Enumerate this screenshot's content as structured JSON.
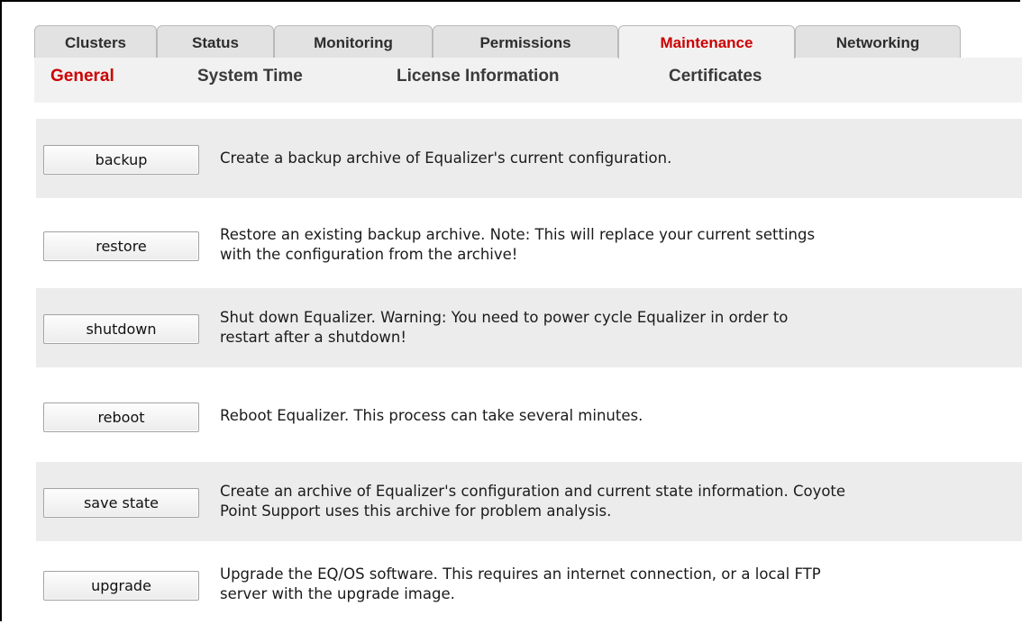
{
  "tabs": [
    {
      "label": "Clusters",
      "active": false
    },
    {
      "label": "Status",
      "active": false
    },
    {
      "label": "Monitoring",
      "active": false
    },
    {
      "label": "Permissions",
      "active": false
    },
    {
      "label": "Maintenance",
      "active": true
    },
    {
      "label": "Networking",
      "active": false
    }
  ],
  "subtabs": [
    {
      "label": "General",
      "active": true
    },
    {
      "label": "System Time",
      "active": false
    },
    {
      "label": "License Information",
      "active": false
    },
    {
      "label": "Certificates",
      "active": false
    }
  ],
  "actions": [
    {
      "button": "backup",
      "description": "Create a backup archive of Equalizer's current configuration."
    },
    {
      "button": "restore",
      "description": "Restore an existing backup archive. Note: This will replace your current settings\nwith the configuration from the archive!"
    },
    {
      "button": "shutdown",
      "description": "Shut down Equalizer. Warning: You need to power cycle Equalizer in order to\nrestart after a shutdown!"
    },
    {
      "button": "reboot",
      "description": "Reboot Equalizer. This process can take several minutes."
    },
    {
      "button": "save state",
      "description": "Create an archive of Equalizer's configuration and current state information. Coyote\nPoint Support uses this archive for problem analysis."
    },
    {
      "button": "upgrade",
      "description": "Upgrade the EQ/OS software. This requires an internet connection, or a local FTP\nserver with the upgrade image."
    }
  ],
  "colors": {
    "accent": "#cc0000",
    "tab_bg": "#e2e2e2",
    "panel_bg": "#f1f1f1",
    "row_shade": "#ececec"
  }
}
